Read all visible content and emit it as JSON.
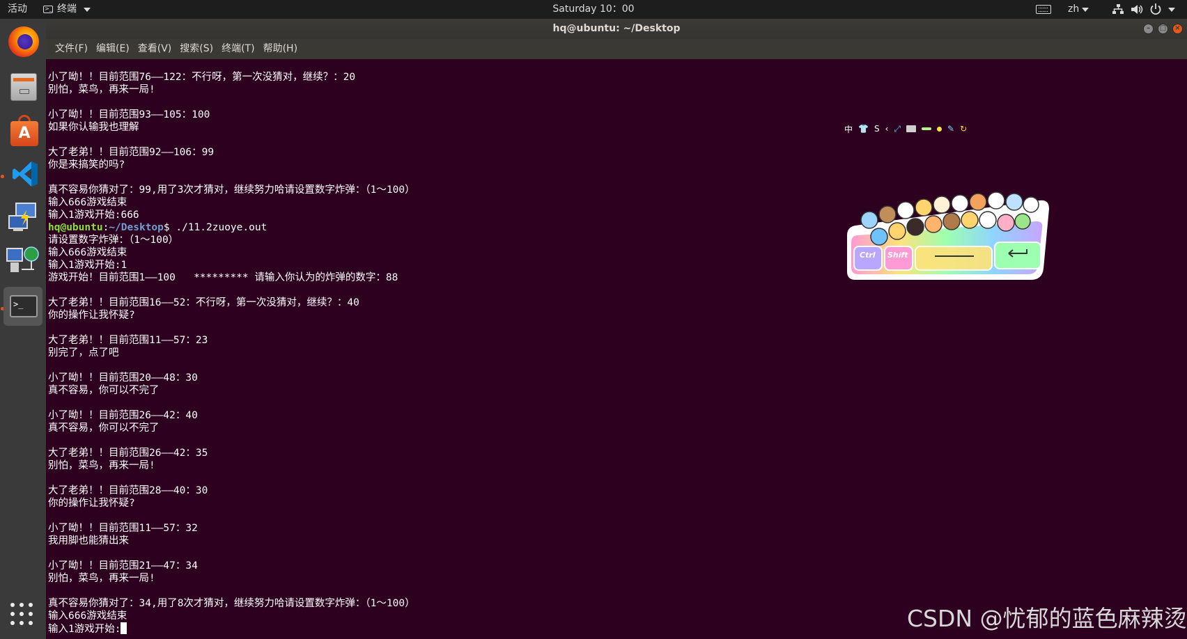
{
  "top_panel": {
    "activities": "活动",
    "app_menu": "终端",
    "clock": "Saturday 10：00",
    "input_lang": "zh"
  },
  "dock": {
    "apps": [
      "firefox",
      "files",
      "ubuntu-software",
      "vscode",
      "remote-desktop",
      "network",
      "terminal"
    ],
    "show_apps": "show-applications"
  },
  "window": {
    "title": "hq@ubuntu: ~/Desktop",
    "menu": {
      "file": "文件(F)",
      "edit": "编辑(E)",
      "view": "查看(V)",
      "search": "搜索(S)",
      "terminal": "终端(T)",
      "help": "帮助(H)"
    }
  },
  "terminal": {
    "lines": [
      "小了呦！！目前范围76——122：不行呀，第一次没猜对，继续？：20",
      "别怕，菜鸟，再来一局!",
      "",
      "小了呦！！目前范围93——105：100",
      "如果你认输我也理解",
      "",
      "大了老弟！！目前范围92——106：99",
      "你是来搞笑的吗?",
      "",
      "真不容易你猜对了：99,用了3次才猜对，继续努力哈请设置数字炸弹：（1～100）",
      "输入666游戏结束",
      "输入1游戏开始:666"
    ],
    "prompt": {
      "user": "hq@ubuntu",
      "path": "~/Desktop",
      "symbol": "$",
      "command": " ./11.2zuoye.out"
    },
    "lines_after": [
      "请设置数字炸弹：（1～100）",
      "输入666游戏结束",
      "输入1游戏开始:1",
      "游戏开始！目前范围1——100   ********* 请输入你认为的炸弹的数字：88",
      "",
      "大了老弟！！目前范围16——52：不行呀，第一次没猜对，继续？：40",
      "你的操作让我怀疑?",
      "",
      "大了老弟！！目前范围11——57：23",
      "别完了，点了吧",
      "",
      "小了呦！！目前范围20——48：30",
      "真不容易，你可以不完了",
      "",
      "小了呦！！目前范围26——42：40",
      "真不容易，你可以不完了",
      "",
      "大了老弟！！目前范围26——42：35",
      "别怕，菜鸟，再来一局!",
      "",
      "大了老弟！！目前范围28——40：30",
      "你的操作让我怀疑?",
      "",
      "小了呦！！目前范围11——57：32",
      "我用脚也能猜出来",
      "",
      "小了呦！！目前范围21——47：34",
      "别怕，菜鸟，再来一局!",
      "",
      "真不容易你猜对了：34,用了8次才猜对，继续努力哈请设置数字炸弹：（1～100）",
      "输入666游戏结束"
    ],
    "last_line": "输入1游戏开始:"
  },
  "ime_toolbar": {
    "mode": "中",
    "s_label": "S"
  },
  "sticker": {
    "key_ctrl": "Ctrl",
    "key_shift": "Shift"
  },
  "watermark": "CSDN @忧郁的蓝色麻辣烫",
  "colors": {
    "terminal_bg": "#2c001e",
    "prompt_user": "#8ae234",
    "prompt_path": "#729fcf",
    "accent": "#e95420"
  }
}
